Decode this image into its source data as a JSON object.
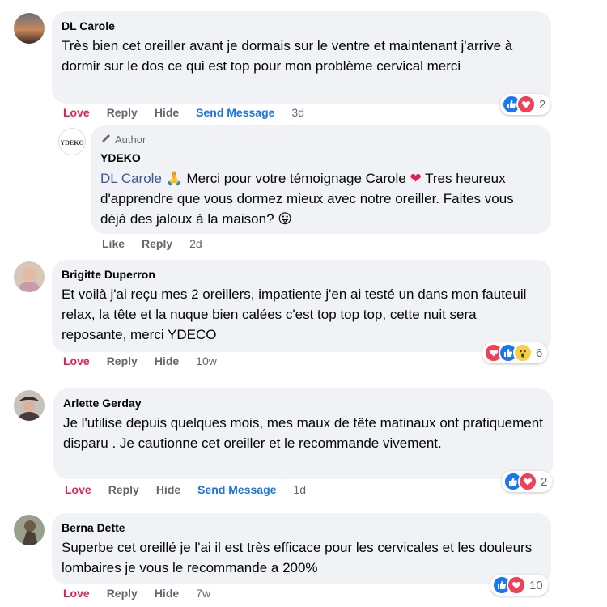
{
  "labels": {
    "love": "Love",
    "like": "Like",
    "reply": "Reply",
    "hide": "Hide",
    "send_message": "Send Message",
    "author": "Author"
  },
  "comments": [
    {
      "name": "DL Carole",
      "text": "Très bien cet oreiller avant je dormais sur le ventre et maintenant j'arrive à dormir sur le dos ce qui est top pour mon problème cervical merci",
      "time": "3d",
      "reaction_count": "2",
      "reactions": [
        "like-icon",
        "love-icon"
      ]
    },
    {
      "name": "YDEKO",
      "mention": "DL Carole",
      "text_after_mention": " Merci pour votre témoignage Carole ",
      "text_tail": " Tres heureux d'apprendre que vous dormez mieux avec notre oreiller. Faites vous déjà des jaloux à la maison? ",
      "time": "2d",
      "avatar_text": "YDEKO"
    },
    {
      "name": "Brigitte Duperron",
      "text": "Et voilà j'ai reçu mes 2 oreillers, impatiente j'en ai testé un dans mon fauteuil relax, la tête et la nuque bien calées c'est top top top, cette nuit sera reposante, merci YDECO",
      "time": "10w",
      "reaction_count": "6",
      "reactions": [
        "love-icon",
        "like-icon",
        "wow-icon"
      ]
    },
    {
      "name": "Arlette Gerday",
      "text": "Je l'utilise depuis quelques mois, mes maux de tête matinaux ont pratiquement disparu . Je cautionne cet oreiller et le recommande vivement.",
      "time": "1d",
      "reaction_count": "2",
      "reactions": [
        "like-icon",
        "love-icon"
      ]
    },
    {
      "name": "Berna Dette",
      "text": "Superbe cet oreillé je l'ai il est très efficace pour les cervicales et les douleurs lombaires je vous le recommande a 200%",
      "time": "7w",
      "reaction_count": "10",
      "reactions": [
        "like-icon",
        "love-icon"
      ]
    }
  ],
  "colors": {
    "bubble": "#f0f2f5",
    "love_text": "#e0224e",
    "link_blue": "#1b74e4",
    "mention": "#385898",
    "like_reaction": "#1877f2",
    "love_reaction": "#f33e58"
  }
}
